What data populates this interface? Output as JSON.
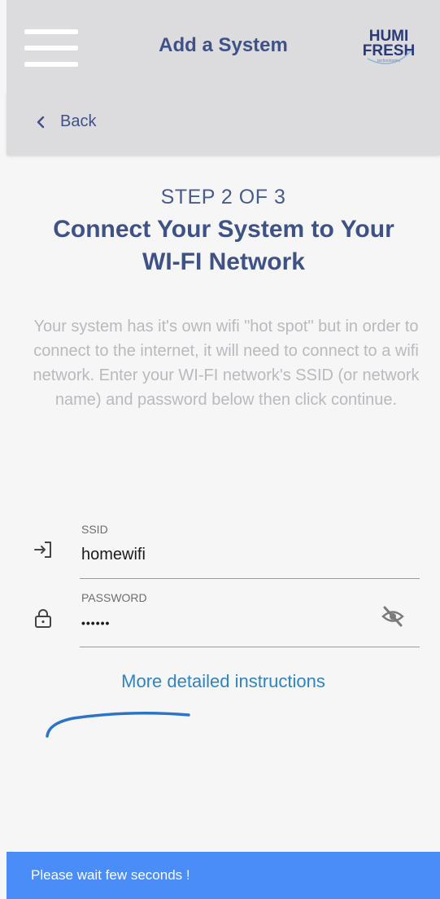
{
  "header": {
    "title": "Add a System",
    "menu_icon": "hamburger-menu-icon",
    "logo": {
      "line1": "HUMI",
      "line2": "FRESH",
      "tagline": "technologies"
    },
    "bg_color": "#dcdbde"
  },
  "nav": {
    "back_label": "Back",
    "back_icon": "chevron-left-icon"
  },
  "step": {
    "label": "STEP 2 OF 3",
    "title": "Connect Your System to Your WI-FI Network",
    "description": "Your system has it's own wifi \"hot spot\" but in order to connect to the internet, it will need to connect to a wifi network. Enter your WI-FI network's SSID (or network name) and password below then click continue."
  },
  "form": {
    "ssid": {
      "label": "SSID",
      "value": "homewifi",
      "icon": "login-arrow-icon"
    },
    "password": {
      "label": "PASSWORD",
      "value": "••••••",
      "icon": "lock-icon",
      "toggle_icon": "eye-off-icon"
    }
  },
  "more_instructions_label": "More detailed instructions",
  "toast": {
    "message": "Please wait few seconds !",
    "color": "#4a8df8"
  },
  "colors": {
    "primary": "#3f5286",
    "link": "#2f84c4",
    "muted_text": "#b9b9bf"
  }
}
